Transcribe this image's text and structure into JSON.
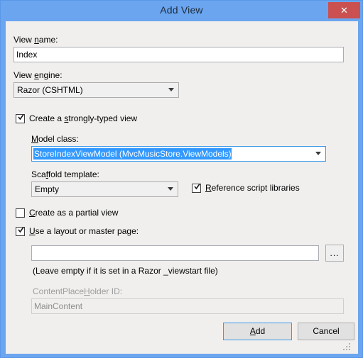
{
  "window": {
    "title": "Add View",
    "close_label": "✕",
    "titlebar_color": "#6ba5ef",
    "client_color": "#f0efee",
    "close_color": "#cb5050",
    "accent_color": "#3399ff"
  },
  "fields": {
    "view_name_label": "View name:",
    "view_name_value": "Index",
    "view_engine_label": "View engine:",
    "view_engine_value": "Razor (CSHTML)",
    "model_class_label": "Model class:",
    "model_class_value": "StoreIndexViewModel (MvcMusicStore.ViewModels)",
    "scaffold_template_label": "Scaffold template:",
    "scaffold_template_value": "Empty",
    "layout_page_value": "",
    "layout_page_hint": "(Leave empty if it is set in a Razor _viewstart file)",
    "content_placeholder_label": "ContentPlaceHolder ID:",
    "content_placeholder_value": "MainContent",
    "browse_label": "..."
  },
  "checkboxes": {
    "strongly_typed": {
      "label": "Create a strongly-typed view",
      "checked": true
    },
    "reference_scripts": {
      "label": "Reference script libraries",
      "checked": true
    },
    "partial_view": {
      "label": "Create as a partial view",
      "checked": false
    },
    "use_layout": {
      "label": "Use a layout or master page:",
      "checked": true
    }
  },
  "buttons": {
    "add_label": "Add",
    "cancel_label": "Cancel"
  }
}
